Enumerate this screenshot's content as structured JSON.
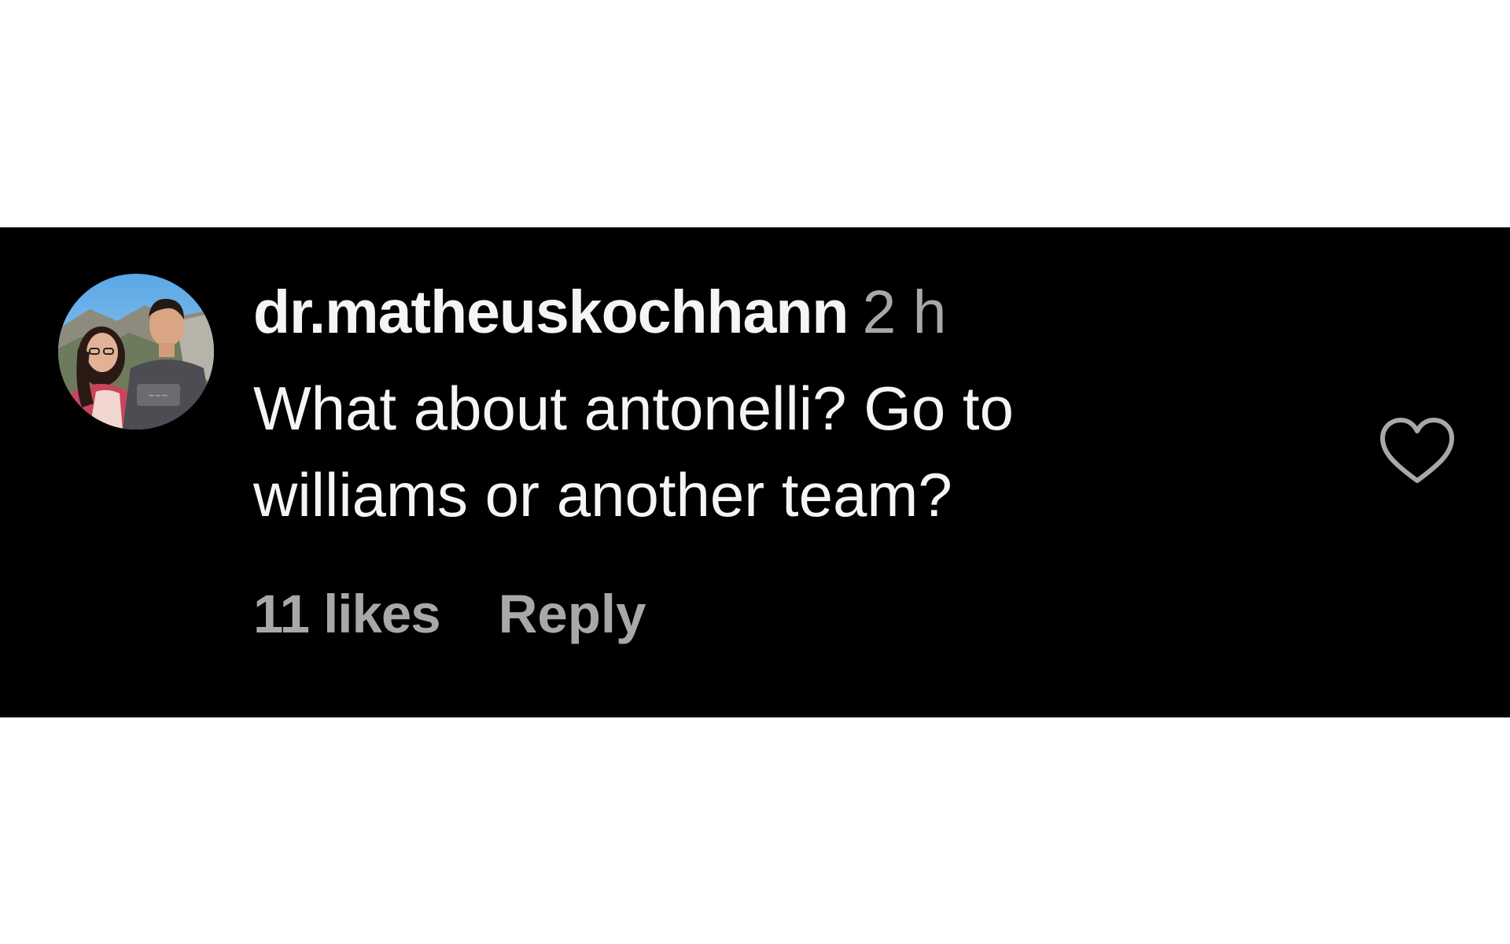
{
  "comment": {
    "username": "dr.matheuskochhann",
    "timestamp": "2 h",
    "text": "What about antonelli? Go to williams or another team?",
    "likes": "11 likes",
    "reply_label": "Reply"
  },
  "icons": {
    "like": "heart-outline-icon",
    "avatar": "profile-photo"
  },
  "colors": {
    "band_background": "#000000",
    "primary_text": "#f5f5f5",
    "secondary_text": "#a8a8a8"
  }
}
